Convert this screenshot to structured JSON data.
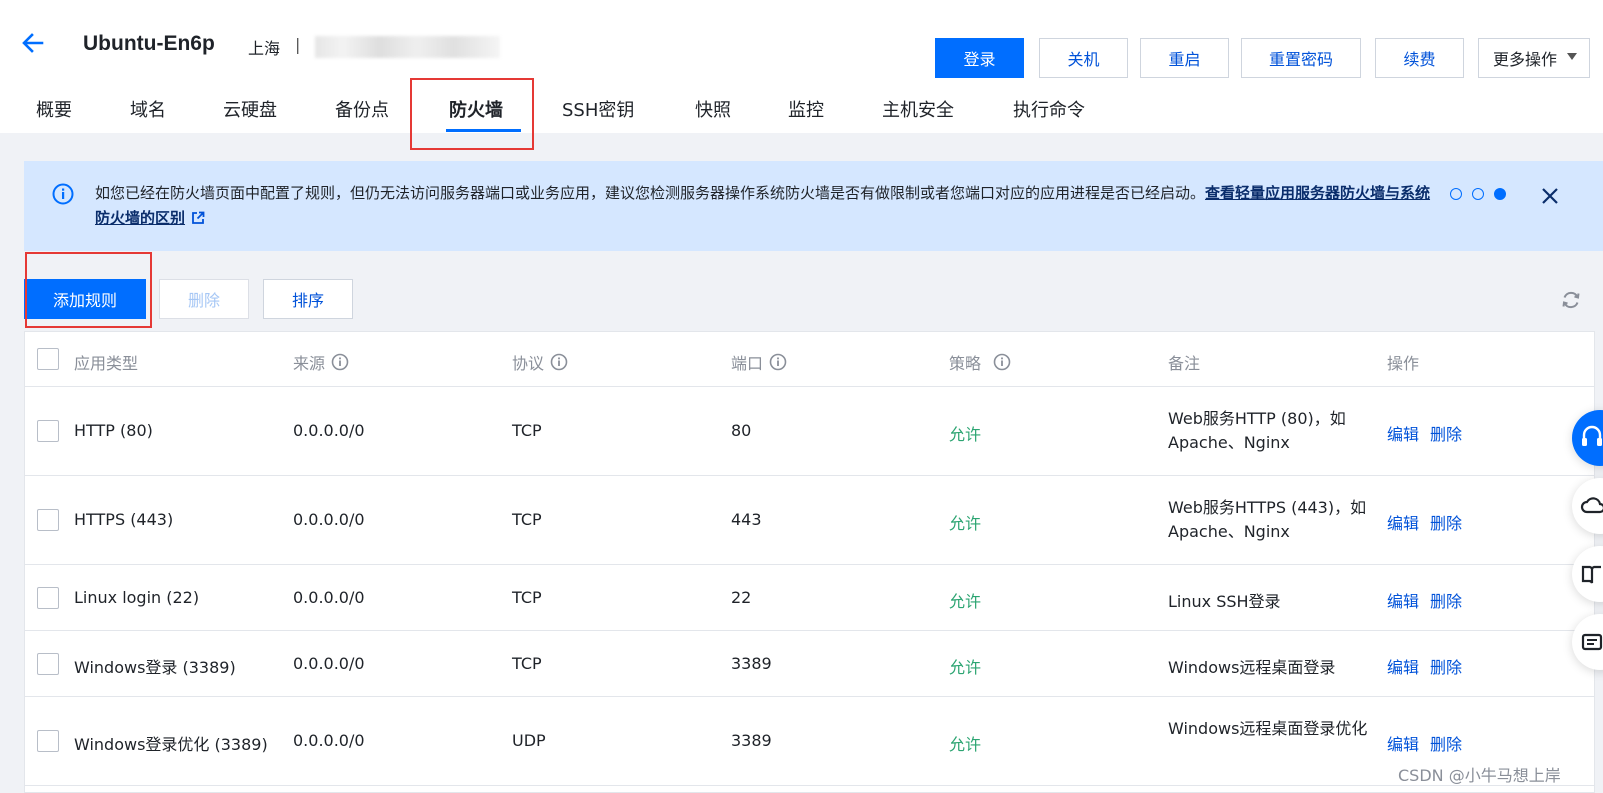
{
  "header": {
    "title": "Ubuntu-En6p",
    "region": "上海",
    "separator": "|",
    "buttons": {
      "login": "登录",
      "shutdown": "关机",
      "restart": "重启",
      "reset_password": "重置密码",
      "renew": "续费",
      "more": "更多操作"
    }
  },
  "tabs": [
    "概要",
    "域名",
    "云硬盘",
    "备份点",
    "防火墙",
    "SSH密钥",
    "快照",
    "监控",
    "主机安全",
    "执行命令"
  ],
  "active_tab": "防火墙",
  "notice": {
    "text": "如您已经在防火墙页面中配置了规则，但仍无法访问服务器端口或业务应用，建议您检测服务器操作系统防火墙是否有做限制或者您端口对应的应用进程是否已经启动。",
    "link": "查看轻量应用服务器防火墙与系统防火墙的区别",
    "pager_current": 3,
    "pager_total": 3
  },
  "toolbar": {
    "add": "添加规则",
    "delete": "删除",
    "sort": "排序"
  },
  "table": {
    "headers": {
      "app_type": "应用类型",
      "source": "来源",
      "protocol": "协议",
      "port": "端口",
      "policy": "策略",
      "note": "备注",
      "actions": "操作"
    },
    "rows": [
      {
        "app_type": "HTTP (80)",
        "source": "0.0.0.0/0",
        "protocol": "TCP",
        "port": "80",
        "policy": "允许",
        "note": "Web服务HTTP (80)，如Apache、Nginx",
        "edit": "编辑",
        "delete": "删除"
      },
      {
        "app_type": "HTTPS (443)",
        "source": "0.0.0.0/0",
        "protocol": "TCP",
        "port": "443",
        "policy": "允许",
        "note": "Web服务HTTPS (443)，如 Apache、Nginx",
        "edit": "编辑",
        "delete": "删除"
      },
      {
        "app_type": "Linux login (22)",
        "source": "0.0.0.0/0",
        "protocol": "TCP",
        "port": "22",
        "policy": "允许",
        "note": "Linux SSH登录",
        "edit": "编辑",
        "delete": "删除"
      },
      {
        "app_type": "Windows登录 (3389)",
        "source": "0.0.0.0/0",
        "protocol": "TCP",
        "port": "3389",
        "policy": "允许",
        "note": "Windows远程桌面登录",
        "edit": "编辑",
        "delete": "删除"
      },
      {
        "app_type": "Windows登录优化 (3389)",
        "source": "0.0.0.0/0",
        "protocol": "UDP",
        "port": "3389",
        "policy": "允许",
        "note": "Windows远程桌面登录优化",
        "edit": "编辑",
        "delete": "删除"
      }
    ]
  },
  "watermark": "CSDN @小牛马想上岸",
  "colors": {
    "primary": "#006eff",
    "link": "#0052d9",
    "allow": "#2ba471",
    "notice_bg": "#d5e7ff",
    "highlight_box": "#e53935"
  }
}
